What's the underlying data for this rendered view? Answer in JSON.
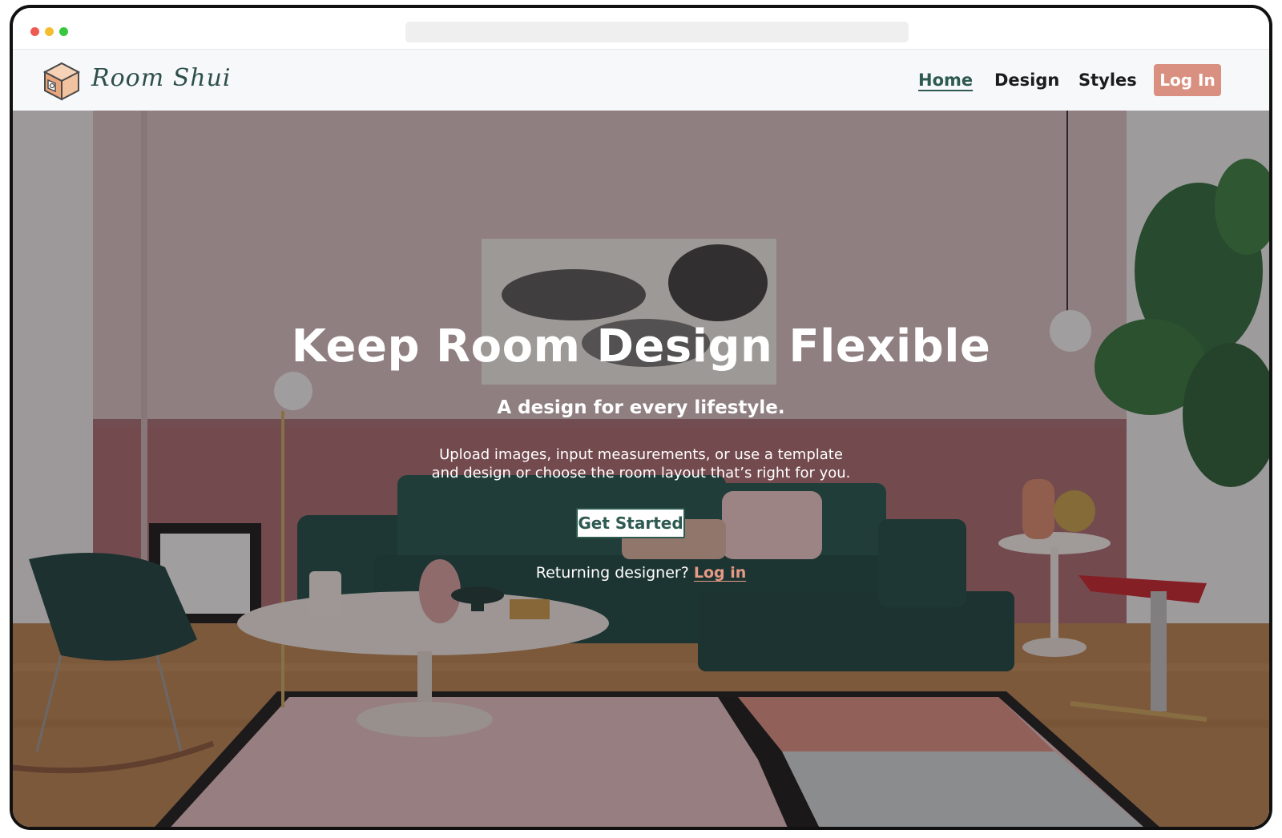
{
  "brand": {
    "name": "Room Shui",
    "logo_icon": "isometric-room-cube-icon",
    "text_color": "#2e5048"
  },
  "nav": {
    "items": [
      {
        "label": "Home",
        "active": true
      },
      {
        "label": "Design",
        "active": false
      },
      {
        "label": "Styles",
        "active": false
      }
    ],
    "login_label": "Log In",
    "login_color": "#d99080"
  },
  "hero": {
    "title": "Keep Room Design Flexible",
    "subtitle": "A design for every lifestyle.",
    "description_line1": "Upload images, input measurements, or use a template",
    "description_line2": "and design or choose the room layout that’s right for you.",
    "cta_label": "Get Started",
    "returning_text": "Returning designer?",
    "returning_link": "Log in",
    "accent_color": "#2e5a4f",
    "link_color": "#e79a86"
  }
}
